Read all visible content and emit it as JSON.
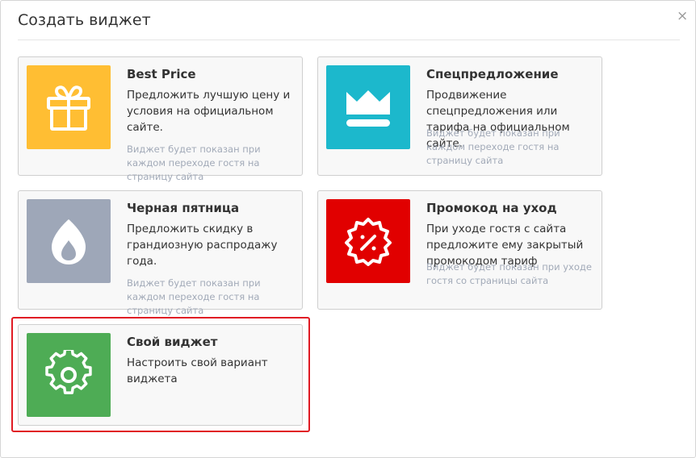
{
  "dialog": {
    "title": "Создать виджет",
    "close_symbol": "×"
  },
  "colors": {
    "best_price": "#ffbe33",
    "special_offer": "#1cb8cc",
    "black_friday": "#9ea7b8",
    "exit_promo": "#e10000",
    "custom": "#4eac55",
    "highlight": "#e01b24"
  },
  "widgets": [
    {
      "icon": "gift-icon",
      "title": "Best Price",
      "description": "Предложить лучшую цену и условия на официальном сайте.",
      "note": "Виджет будет показан при каждом переходе гостя на страницу сайта"
    },
    {
      "icon": "crown-icon",
      "title": "Спецпредложение",
      "description": "Продвижение спецпредложения или тарифа на официальном сайте.",
      "note": "Виджет будет показан при каждом переходе гостя на страницу сайта"
    },
    {
      "icon": "flame-icon",
      "title": "Черная пятница",
      "description": "Предложить скидку в грандиозную распродажу года.",
      "note": "Виджет будет показан при каждом переходе гостя на страницу сайта"
    },
    {
      "icon": "discount-badge-icon",
      "title": "Промокод на уход",
      "description": "При уходе гостя с сайта предложите ему закрытый промокодом тариф",
      "note": "Виджет будет показан при уходе гостя со страницы сайта"
    },
    {
      "icon": "gear-icon",
      "title": "Свой виджет",
      "description": "Настроить свой вариант виджета",
      "note": ""
    }
  ]
}
